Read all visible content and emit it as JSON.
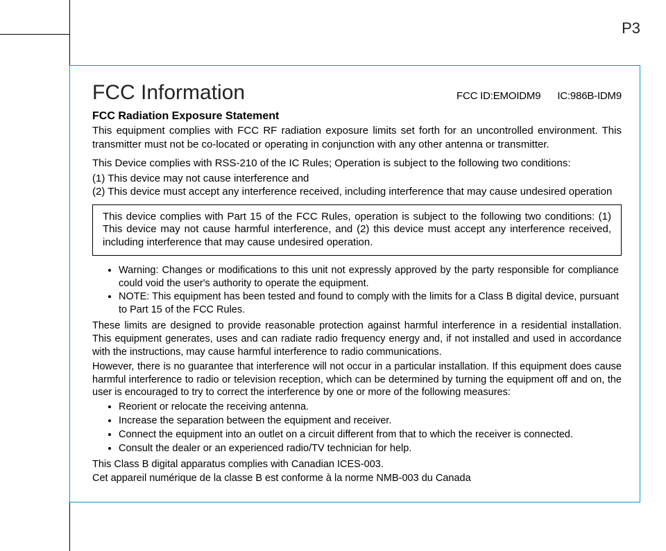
{
  "page_number": "P3",
  "title": "FCC Information",
  "ids": {
    "fcc": "FCC ID:EMOIDM9",
    "ic": "IC:986B-IDM9"
  },
  "subheading": "FCC Radiation Exposure Statement",
  "exposure_para": "This equipment complies with FCC RF radiation exposure limits set forth for an uncontrolled environment. This transmitter must not be co-located or operating in conjunction with any other antenna or transmitter.",
  "rss_intro": "This Device complies with RSS-210 of the IC Rules; Operation is subject to the following two conditions:",
  "rss_items": [
    "(1) This device may not cause interference and",
    "(2) This device must accept any interference received, including interference that may cause undesired operation"
  ],
  "framed": "This device complies with Part 15 of the FCC Rules, operation is subject to the following two conditions: (1) This device may not cause harmful interference, and (2) this device must accept any interference received, including interference that may cause undesired operation.",
  "warn_bullets": [
    "Warning: Changes or modifications to this unit not expressly approved by the party responsible for compliance could void the user's authority to operate the equipment.",
    "NOTE: This equipment has been tested and found to comply with the limits for a Class B digital device, pursuant to Part 15 of the FCC Rules."
  ],
  "body_paras": [
    "These limits are designed to provide reasonable protection against harmful interference in a residential installation. This equipment generates, uses and can radiate radio frequency energy and, if not installed and used in accordance with the instructions, may cause harmful interference to radio communications.",
    "However, there is no guarantee that interference will not occur in a particular installation. If this equipment does cause harmful interference to radio or television reception, which can be determined by turning the equipment off and on, the user is encouraged to try to correct the interference by one or more of the following measures:"
  ],
  "measure_bullets": [
    "Reorient or relocate the receiving antenna.",
    "Increase the separation between the equipment and receiver.",
    "Connect the equipment into an outlet on a circuit different from that to which the receiver is connected.",
    "Consult the dealer or an experienced radio/TV technician for help."
  ],
  "closing_paras": [
    "This Class B digital apparatus complies with Canadian ICES-003.",
    "Cet appareil numérique de la classe B est conforme à la norme NMB-003 du Canada"
  ]
}
